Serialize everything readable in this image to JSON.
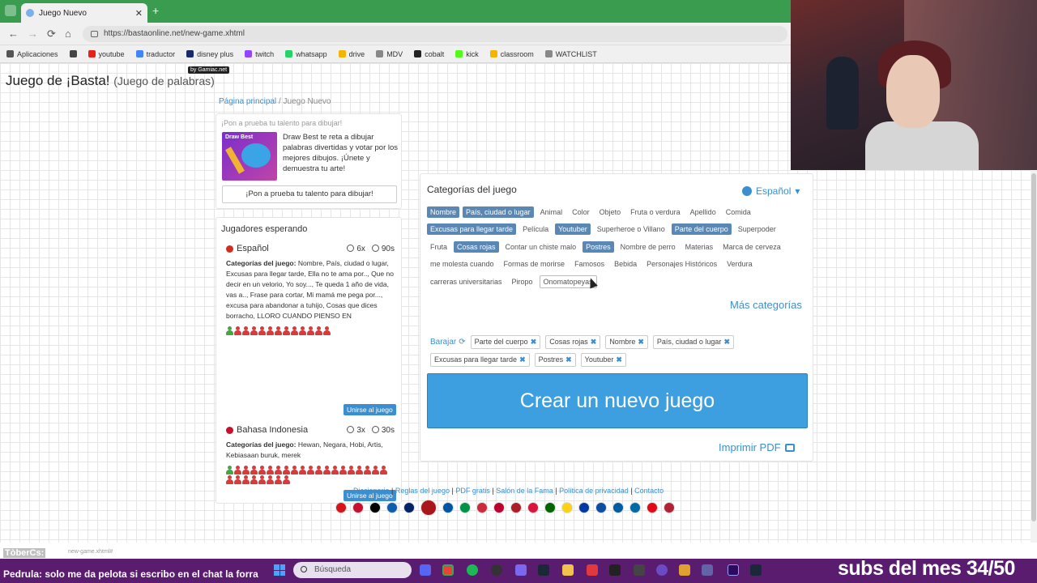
{
  "browser": {
    "tab_title": "Juego Nuevo",
    "tab_close": "✕",
    "new_tab": "+",
    "url": "https://bastaonline.net/new-game.xhtml",
    "nav": {
      "back": "←",
      "forward": "→",
      "reload": "⟳",
      "home": "⌂"
    },
    "bookmarks": [
      {
        "label": "Aplicaciones",
        "color": "#555555"
      },
      {
        "label": "",
        "color": "#444444"
      },
      {
        "label": "youtube",
        "color": "#e62117"
      },
      {
        "label": "traductor",
        "color": "#4285f4"
      },
      {
        "label": "disney plus",
        "color": "#1a2b6d"
      },
      {
        "label": "twitch",
        "color": "#9146ff"
      },
      {
        "label": "whatsapp",
        "color": "#25d366"
      },
      {
        "label": "drive",
        "color": "#f4b400"
      },
      {
        "label": "MDV",
        "color": "#888888"
      },
      {
        "label": "cobalt",
        "color": "#222222"
      },
      {
        "label": "kick",
        "color": "#53fc18"
      },
      {
        "label": "classroom",
        "color": "#f4b400"
      },
      {
        "label": "WATCHLIST",
        "color": "#888888"
      }
    ]
  },
  "site": {
    "title": "Juego de ¡Basta!",
    "subtitle": "(Juego de palabras)",
    "badge": "by Gamiac.net",
    "breadcrumb": {
      "home": "Página principal",
      "sep": "/",
      "current": "Juego Nuevo"
    }
  },
  "ad": {
    "header": "¡Pon a prueba tu talento para dibujar!",
    "image_title": "Draw Best",
    "text": "Draw Best te reta a dibujar palabras divertidas y votar por los mejores dibujos. ¡Únete y demuestra tu arte!",
    "button": "¡Pon a prueba tu talento para dibujar!"
  },
  "players": {
    "title": "Jugadores esperando",
    "games": [
      {
        "language": "Español",
        "flag_color": "#d52b1e",
        "rounds": "6x",
        "time": "90s",
        "cats_label": "Categorías del juego:",
        "cats": "Nombre, País, ciudad o lugar, Excusas para llegar tarde, Ella no te ama por.., Que no decir en un velorio, Yo soy..., Te queda 1 año de vida, vas a.., Frase para cortar, Mi mamá me pega por..., excusa para abandonar a tuhijo, Cosas que dices borracho, LLORO CUANDO PIENSO EN",
        "players_green": 1,
        "players_red": 12,
        "join": "Unirse al juego"
      },
      {
        "language": "Bahasa Indonesia",
        "flag_color": "#c8102e",
        "rounds": "3x",
        "time": "30s",
        "cats_label": "Categorías del juego:",
        "cats": "Hewan, Negara, Hobi, Artis, Kebiasaan buruk, merek",
        "players_green": 1,
        "players_red": 27,
        "join": "Unirse al juego"
      }
    ]
  },
  "categories": {
    "title": "Categorías del juego",
    "language": "Español",
    "rows": [
      [
        {
          "label": "Nombre",
          "selected": true
        },
        {
          "label": "País, ciudad o lugar",
          "selected": true
        },
        {
          "label": "Animal",
          "selected": false
        },
        {
          "label": "Color",
          "selected": false
        },
        {
          "label": "Objeto",
          "selected": false
        },
        {
          "label": "Fruta o verdura",
          "selected": false
        },
        {
          "label": "Apellido",
          "selected": false
        },
        {
          "label": "Comida",
          "selected": false
        }
      ],
      [
        {
          "label": "Excusas para llegar tarde",
          "selected": true
        },
        {
          "label": "Película",
          "selected": false
        },
        {
          "label": "Youtuber",
          "selected": true
        },
        {
          "label": "Superheroe o Villano",
          "selected": false
        },
        {
          "label": "Parte del cuerpo",
          "selected": true
        },
        {
          "label": "Superpoder",
          "selected": false
        }
      ],
      [
        {
          "label": "Fruta",
          "selected": false
        },
        {
          "label": "Cosas rojas",
          "selected": true
        },
        {
          "label": "Contar un chiste malo",
          "selected": false
        },
        {
          "label": "Postres",
          "selected": true
        },
        {
          "label": "Nombre de perro",
          "selected": false
        },
        {
          "label": "Materias",
          "selected": false
        },
        {
          "label": "Marca de cerveza",
          "selected": false
        }
      ],
      [
        {
          "label": "me molesta cuando",
          "selected": false
        },
        {
          "label": "Formas de morirse",
          "selected": false
        },
        {
          "label": "Famosos",
          "selected": false
        },
        {
          "label": "Bebida",
          "selected": false
        },
        {
          "label": "Personajes Históricos",
          "selected": false
        },
        {
          "label": "Verdura",
          "selected": false
        }
      ],
      [
        {
          "label": "carreras universitarias",
          "selected": false
        },
        {
          "label": "Piropo",
          "selected": false
        },
        {
          "label": "Onomatopeyas",
          "selected": false,
          "hover": true
        }
      ]
    ],
    "more": "Más categorías",
    "shuffle": "Barajar",
    "chosen_rows": [
      [
        "Parte del cuerpo",
        "Cosas rojas",
        "Nombre",
        "País, ciudad o lugar"
      ],
      [
        "Excusas para llegar tarde",
        "Postres",
        "Youtuber"
      ]
    ],
    "remove_symbol": "✖"
  },
  "actions": {
    "create": "Crear un nuevo juego",
    "print": "Imprimir PDF"
  },
  "footer": {
    "links": [
      "Diccionario",
      "Reglas del juego",
      "PDF gratis",
      "Salón de la Fama",
      "Política de privacidad",
      "Contacto"
    ],
    "sep": "|",
    "flags": [
      "#d7141a",
      "#c8102e",
      "#000000",
      "#0d5eaf",
      "#012169",
      "#aa151b",
      "#0055a4",
      "#009246",
      "#cd2a3e",
      "#bc002d",
      "#ae1c28",
      "#dc143c",
      "#006600",
      "#fcd116",
      "#0039a6",
      "#0b4ea2",
      "#005da4",
      "#006aa7",
      "#e30a17",
      "#b22234"
    ]
  },
  "overlay": {
    "chat_user": "TòberCs:",
    "chat_url": "new-game.xhtml#",
    "chat_line": "Pedrula: solo me da pelota si escribo en el chat la forra",
    "search_placeholder": "Búsqueda",
    "subs": "subs del mes 34/50"
  }
}
